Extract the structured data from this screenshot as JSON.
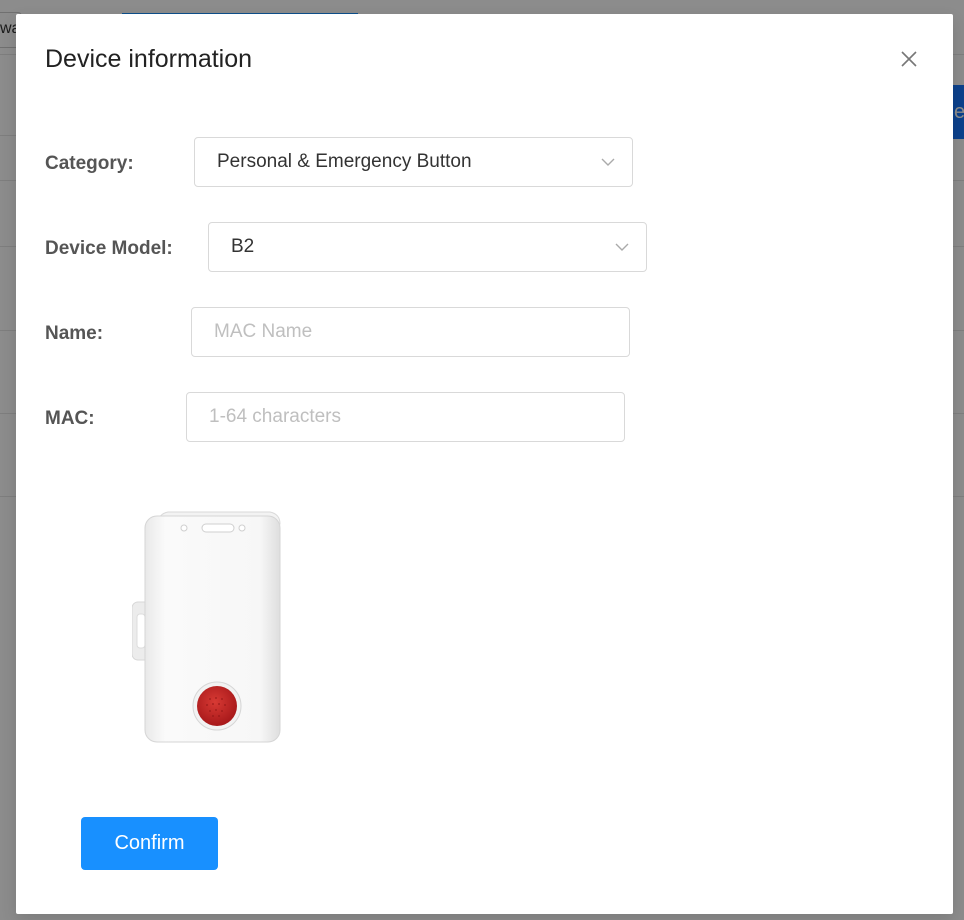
{
  "background": {
    "tab_text": "wa",
    "button_text": "e"
  },
  "modal": {
    "title": "Device information",
    "close_icon": "close-icon",
    "confirm_label": "Confirm"
  },
  "form": {
    "category": {
      "label": "Category:",
      "value": "Personal & Emergency Button"
    },
    "model": {
      "label": "Device Model:",
      "value": "B2"
    },
    "name": {
      "label": "Name:",
      "value": "",
      "placeholder": "MAC Name"
    },
    "mac": {
      "label": "MAC:",
      "value": "",
      "placeholder": "1-64 characters"
    }
  },
  "colors": {
    "primary": "#1890ff",
    "emergency_button": "#c8201f"
  }
}
